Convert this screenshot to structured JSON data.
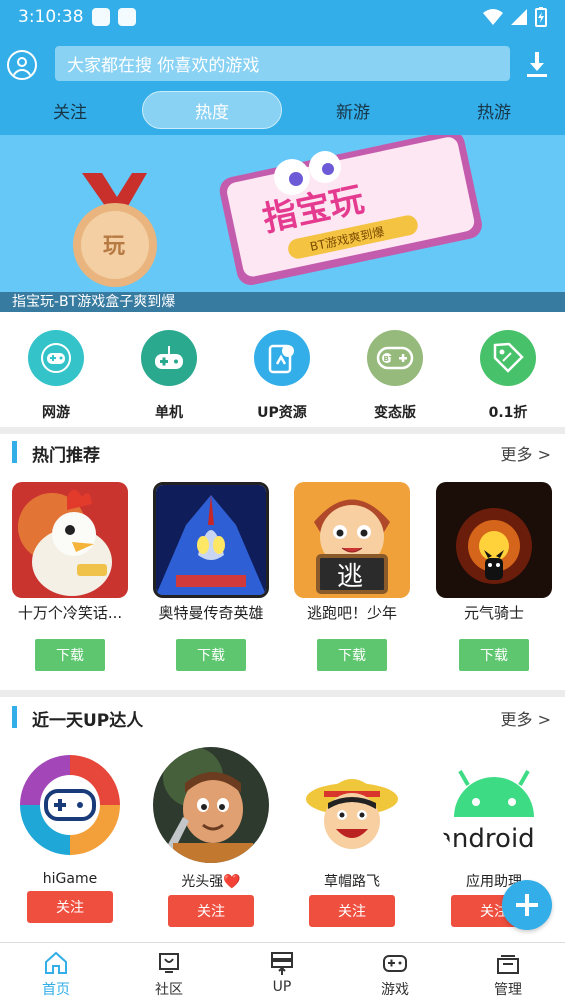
{
  "status_bar": {
    "time": "3:10:38"
  },
  "search": {
    "placeholder": "大家都在搜  你喜欢的游戏"
  },
  "tabs": [
    {
      "label": "关注",
      "active": false
    },
    {
      "label": "热度",
      "active": true
    },
    {
      "label": "新游",
      "active": false
    },
    {
      "label": "热游",
      "active": false
    }
  ],
  "banner": {
    "caption": "指宝玩-BT游戏盒子爽到爆",
    "logo_text": "指宝玩",
    "slogan": "BT游戏爽到爆",
    "medal_text": "玩"
  },
  "categories": [
    {
      "label": "网游",
      "icon": "gamepad-icon",
      "color": "#33c3c9"
    },
    {
      "label": "单机",
      "icon": "joystick-icon",
      "color": "#2aa98e"
    },
    {
      "label": "UP资源",
      "icon": "share-icon",
      "color": "#33aee8"
    },
    {
      "label": "变态版",
      "icon": "bt-gamepad-icon",
      "color": "#96b97c"
    },
    {
      "label": "0.1折",
      "icon": "discount-tag-icon",
      "color": "#47c16a"
    }
  ],
  "hot_section": {
    "title": "热门推荐",
    "more": "更多 >"
  },
  "hot_games": [
    {
      "name": "十万个冷笑话...",
      "button": "下载"
    },
    {
      "name": "奥特曼传奇英雄",
      "button": "下载"
    },
    {
      "name": "逃跑吧！少年",
      "button": "下载",
      "sign_text": "逃"
    },
    {
      "name": "元气骑士",
      "button": "下载"
    }
  ],
  "up_section": {
    "title": "近一天UP达人",
    "more": "更多 >"
  },
  "up_users": [
    {
      "name": "hiGame",
      "button": "关注"
    },
    {
      "name": "光头强❤️",
      "button": "关注"
    },
    {
      "name": "草帽路飞",
      "button": "关注"
    },
    {
      "name": "应用助理",
      "button": "关注",
      "logo_text": "android"
    }
  ],
  "bottom_nav": [
    {
      "label": "首页",
      "icon": "home-icon",
      "active": true
    },
    {
      "label": "社区",
      "icon": "community-icon",
      "active": false
    },
    {
      "label": "UP",
      "icon": "up-server-icon",
      "active": false
    },
    {
      "label": "游戏",
      "icon": "gamepad-icon",
      "active": false
    },
    {
      "label": "管理",
      "icon": "manage-icon",
      "active": false
    }
  ],
  "colors": {
    "primary": "#33aee8",
    "download": "#5dc66e",
    "follow": "#ef4f3f"
  }
}
